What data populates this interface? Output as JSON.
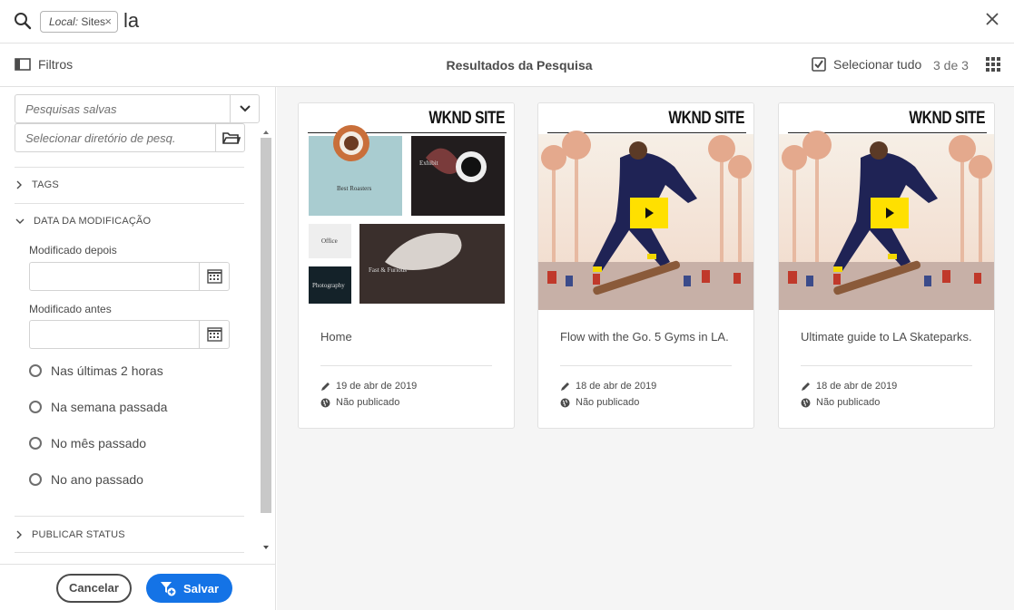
{
  "search": {
    "tag_key": "Local:",
    "tag_value": "Sites",
    "tag_remove": "×",
    "query": "la"
  },
  "toolbar": {
    "filters_label": "Filtros",
    "results_title": "Resultados da Pesquisa",
    "select_all_label": "Selecionar tudo",
    "count": "3 de 3"
  },
  "sidebar": {
    "saved_searches_placeholder": "Pesquisas salvas",
    "directory_placeholder": "Selecionar diretório de pesq.",
    "sections": {
      "tags": "TAGS",
      "modified": "DATA DA MODIFICAÇÃO",
      "publish": "PUBLICAR STATUS"
    },
    "modified_after_label": "Modificado depois",
    "modified_before_label": "Modificado antes",
    "radios": [
      "Nas últimas 2 horas",
      "Na semana passada",
      "No mês passado",
      "No ano passado"
    ],
    "cancel_label": "Cancelar",
    "save_label": "Salvar"
  },
  "cards": [
    {
      "brand": "WKND SITE",
      "title": "Home",
      "date": "19 de abr de 2019",
      "status": "Não publicado",
      "tiles": {
        "roasters": "Best Roasters",
        "exhibit": "Exhibit",
        "office": "Office",
        "photo": "Photography",
        "fast": "Fast & Furious"
      }
    },
    {
      "brand": "WKND SITE",
      "title": "Flow with the Go. 5 Gyms in LA.",
      "date": "18 de abr de 2019",
      "status": "Não publicado"
    },
    {
      "brand": "WKND SITE",
      "title": "Ultimate guide to LA Skateparks.",
      "date": "18 de abr de 2019",
      "status": "Não publicado"
    }
  ],
  "colors": {
    "accent": "#1473e6",
    "play": "#ffe000"
  }
}
